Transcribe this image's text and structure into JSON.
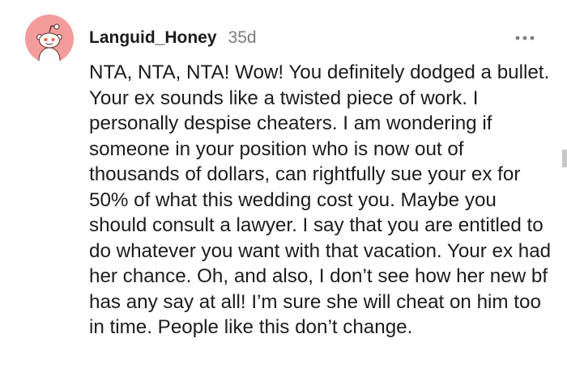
{
  "comment": {
    "author": "Languid_Honey",
    "timestamp": "35d",
    "more_icon": "more-horizontal-icon",
    "avatar": {
      "icon": "reddit-snoo-avatar-icon",
      "background_color": "#f49c9c"
    },
    "body": "NTA, NTA, NTA! Wow! You definitely dodged a bullet. Your ex sounds like a twisted piece of work. I personally despise cheaters. I am wondering if someone in your position who is now out of thousands of dollars, can rightfully sue your ex for 50% of what this wedding cost you. Maybe you should consult a lawyer. I say that you are entitled to do whatever you want with that vacation. Your ex had her chance. Oh, and also, I don’t see how her new bf has any say at all! I’m sure she will cheat on him too in time. People like this don’t change."
  },
  "colors": {
    "text": "#1c1c1c",
    "meta": "#7c7c7c",
    "background": "#ffffff"
  }
}
